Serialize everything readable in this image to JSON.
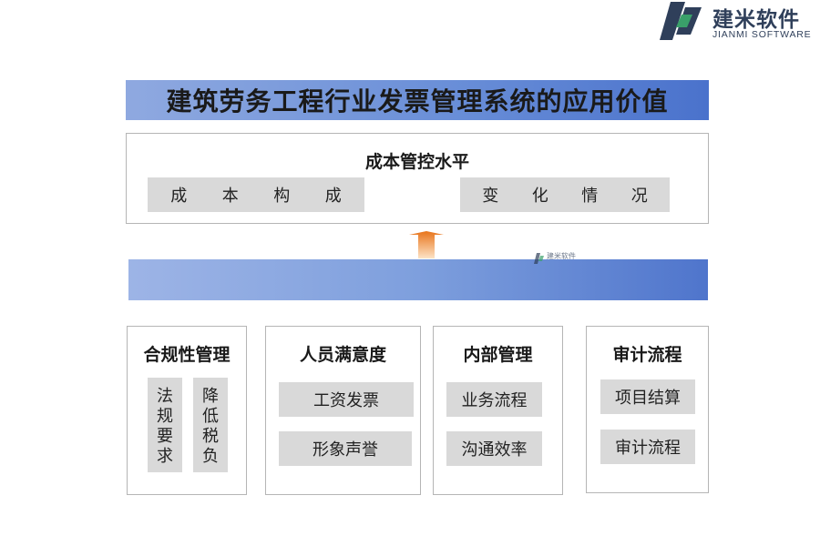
{
  "logo": {
    "title": "建米软件",
    "subtitle": "JIANMI SOFTWARE",
    "watermark": "建米软件",
    "colors": {
      "dark": "#2f3f5a",
      "green": "#3aa06a"
    }
  },
  "title": "建筑劳务工程行业发票管理系统的应用价值",
  "top": {
    "heading": "成本管控水平",
    "left_chip": [
      "成",
      "本",
      "构",
      "成"
    ],
    "right_chip": [
      "变",
      "化",
      "情",
      "况"
    ]
  },
  "cards": [
    {
      "heading": "合规性管理",
      "items": [
        "法规要求",
        "降低税负"
      ]
    },
    {
      "heading": "人员满意度",
      "items": [
        "工资发票",
        "形象声誉"
      ]
    },
    {
      "heading": "内部管理",
      "items": [
        "业务流程",
        "沟通效率"
      ]
    },
    {
      "heading": "审计流程",
      "items": [
        "项目结算",
        "审计流程"
      ]
    }
  ],
  "colors": {
    "banner_start": "#8fa9e0",
    "banner_end": "#4a72cc",
    "chip": "#d9d9d9",
    "arrow": "#f08a24"
  }
}
